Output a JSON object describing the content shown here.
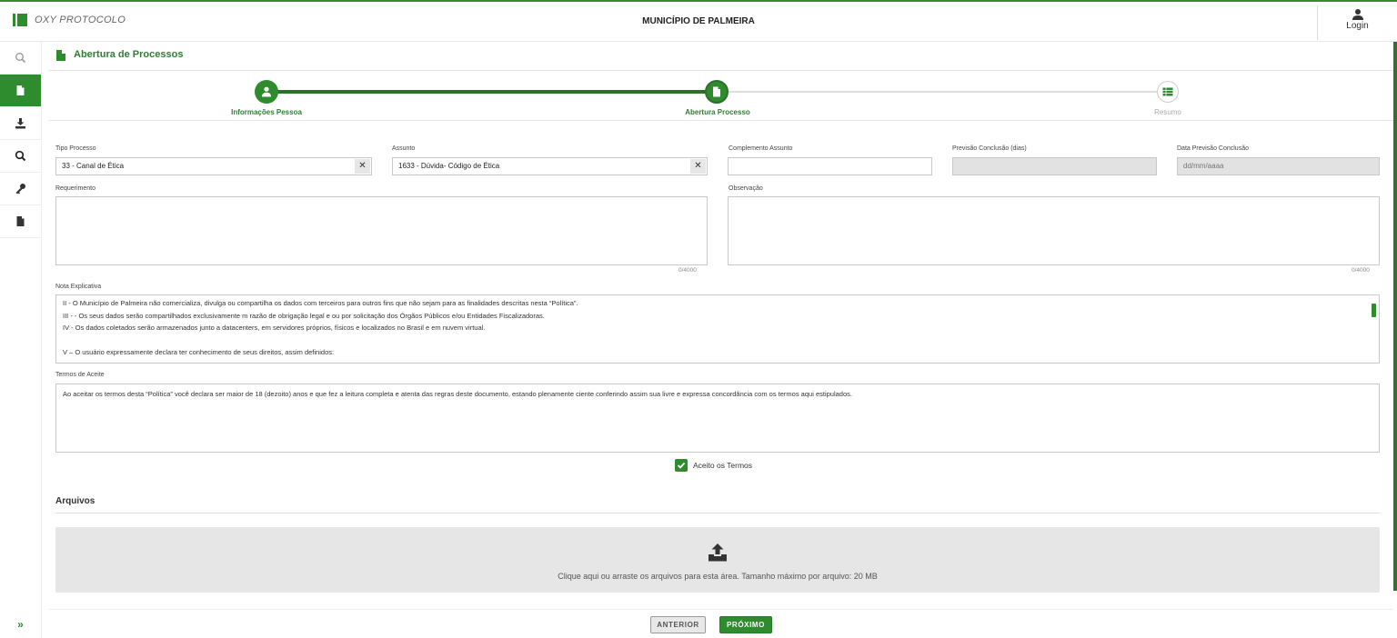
{
  "app": {
    "brand_name": "OXY PROTOCOLO",
    "title": "MUNICÍPIO DE PALMEIRA",
    "login_label": "Login"
  },
  "sidebar": {
    "items": [
      {
        "icon": "search-icon",
        "active": false
      },
      {
        "icon": "document-icon",
        "active": true
      },
      {
        "icon": "download-icon",
        "active": false
      },
      {
        "icon": "search-icon",
        "active": false
      },
      {
        "icon": "key-icon",
        "active": false
      },
      {
        "icon": "document-icon",
        "active": false
      }
    ],
    "expand_label": "»"
  },
  "page": {
    "title": "Abertura de Processos"
  },
  "stepper": {
    "steps": [
      {
        "label": "Informações Pessoa",
        "status": "done"
      },
      {
        "label": "Abertura Processo",
        "status": "current"
      },
      {
        "label": "Resumo",
        "status": "pending"
      }
    ]
  },
  "form": {
    "tipo_processo": {
      "label": "Tipo Processo",
      "value": "33 - Canal de Ética",
      "clear": "✕"
    },
    "assunto": {
      "label": "Assunto",
      "value": "1633 - Dúvida- Código de Ética",
      "clear": "✕"
    },
    "complemento": {
      "label": "Complemento Assunto",
      "value": ""
    },
    "previsao": {
      "label": "Previsão Conclusão (dias)",
      "value": ""
    },
    "data_previsao": {
      "label": "Data Previsão Conclusão",
      "placeholder": "dd/mm/aaaa"
    },
    "requerimento": {
      "label": "Requerimento",
      "value": "",
      "counter": "0/4000"
    },
    "observacao": {
      "label": "Observação",
      "value": "",
      "counter": "0/4000"
    },
    "nota": {
      "label": "Nota Explicativa",
      "lines": [
        "II - O Município de Palmeira não comercializa, divulga ou compartilha os dados com terceiros para outros fins que não sejam para as finalidades descritas nesta “Política”.",
        "III - - Os seus dados serão compartilhados exclusivamente m razão de obrigação legal e ou por solicitação dos Órgãos Públicos e/ou Entidades Fiscalizadoras.",
        "IV - Os dados coletados serão armazenados junto a datacenters, em servidores próprios, físicos e localizados no Brasil e em nuvem virtual.",
        "",
        "V – O usuário expressamente declara ter conhecimento de seus direitos, assim definidos:"
      ]
    },
    "termos": {
      "label": "Termos de Aceite",
      "text": "Ao aceitar os termos desta “Política” você declara ser maior de 18 (dezoito) anos e que fez a leitura completa e atenta das regras deste documento, estando plenamente ciente conferindo assim sua livre e expressa concordância com os termos aqui estipulados."
    },
    "aceito_label": "Aceito os Termos",
    "aceito_checked": true
  },
  "files": {
    "title": "Arquivos",
    "dropzone_text": "Clique aqui ou arraste os arquivos para esta área. Tamanho máximo por arquivo: 20 MB"
  },
  "footer": {
    "prev_label": "ANTERIOR",
    "next_label": "PRÓXIMO"
  },
  "colors": {
    "accent": "#2e8b2e",
    "accent_dark": "#2e6f2a",
    "title_green": "#2e7d32"
  }
}
